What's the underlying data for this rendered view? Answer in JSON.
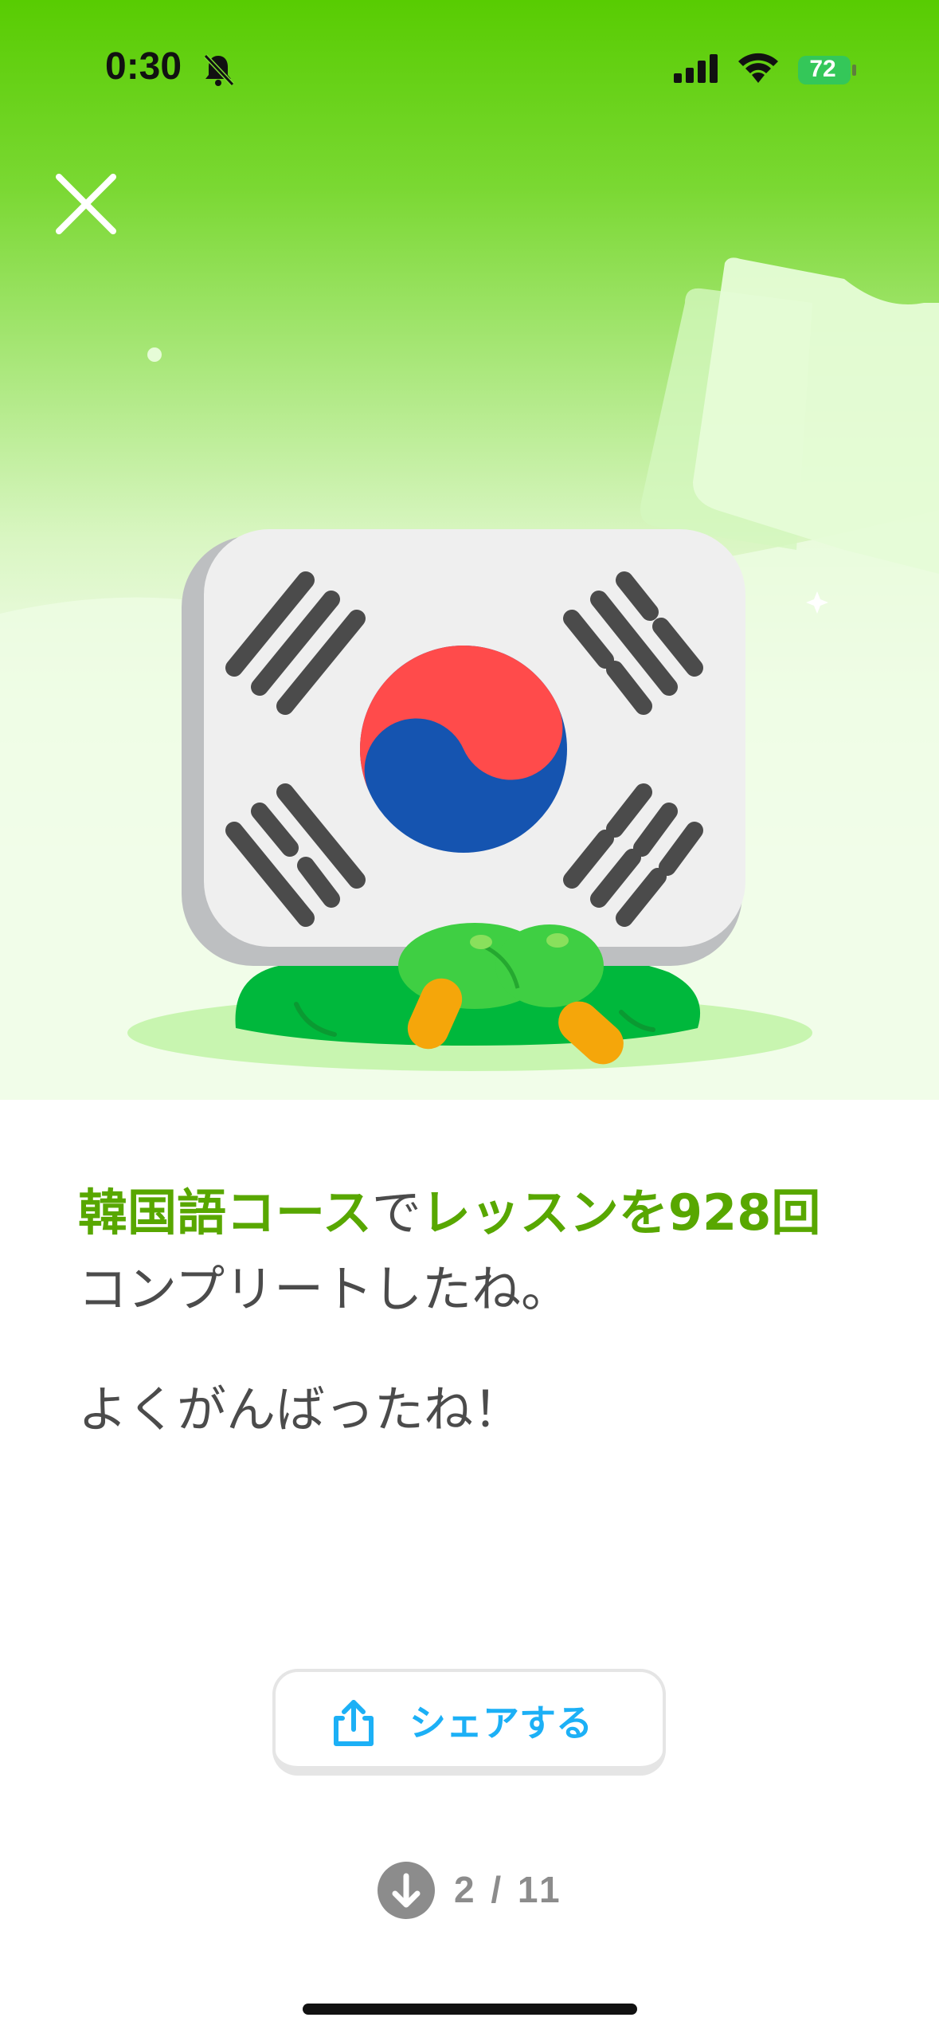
{
  "status_bar": {
    "time": "0:30",
    "battery": "72"
  },
  "message": {
    "part1_highlight": "韓国語コース",
    "part2": "で",
    "part3_highlight": "レッスンを928回",
    "part4": "コンプリートしたね。",
    "sub": "よくがんばったね！"
  },
  "share_button": {
    "label": "シェアする"
  },
  "pager": {
    "text": "2 / 11"
  },
  "colors": {
    "brand_green": "#58cc02",
    "highlight": "#58a700",
    "share_blue": "#1cb0f6"
  },
  "icons": [
    "bell-slash-icon",
    "signal-icon",
    "wifi-icon",
    "battery-icon",
    "close-icon",
    "share-icon",
    "down-arrow-icon"
  ]
}
